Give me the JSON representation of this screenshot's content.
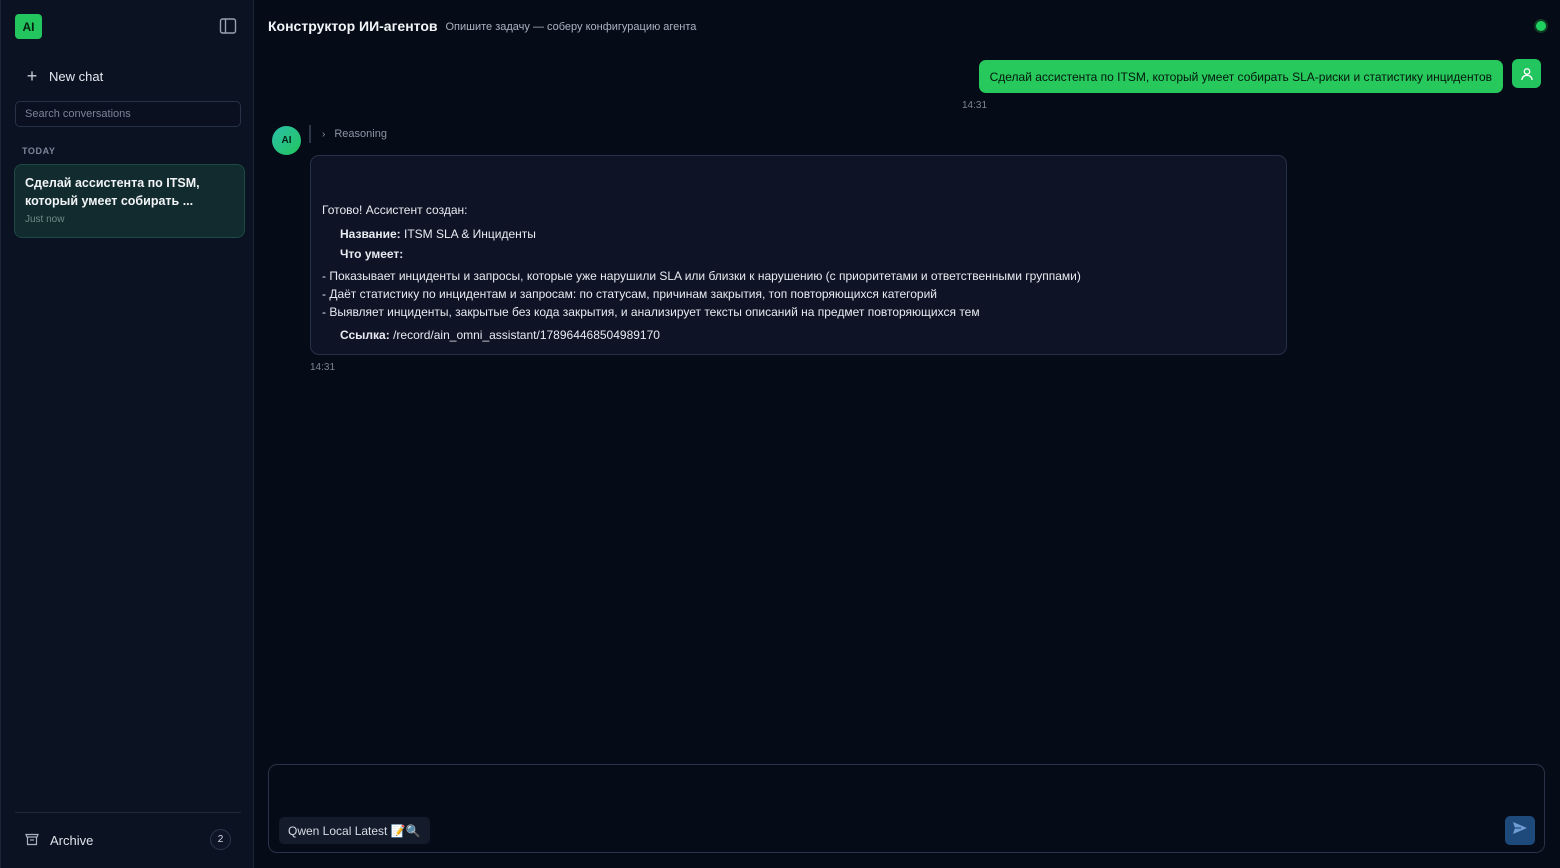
{
  "sidebar": {
    "logo_text": "AI",
    "new_chat_label": "New chat",
    "search_placeholder": "Search conversations",
    "section_today": "TODAY",
    "conversations": [
      {
        "title": "Сделай ассистента по ITSM, который умеет собирать ...",
        "time": "Just now"
      }
    ],
    "archive_label": "Archive",
    "archive_count": "2"
  },
  "header": {
    "title": "Конструктор ИИ-агентов",
    "subtitle": "Опишите задачу — соберу конфигурацию агента",
    "status_color": "#1fd15f"
  },
  "messages": {
    "user": {
      "text": "Сделай ассистента по ITSM, который умеет собирать SLA-риски и статистику инцидентов",
      "time": "14:31"
    },
    "assistant": {
      "avatar_text": "AI",
      "reasoning_label": "Reasoning",
      "intro": "Готово! Ассистент создан:",
      "name_label": "Название:",
      "name_value": "ITSM SLA & Инциденты",
      "can_label": "Что умеет:",
      "bullets": [
        "- Показывает инциденты и запросы, которые уже нарушили SLA или близки к нарушению (с приоритетами и ответственными группами)",
        "- Даёт статистику по инцидентам и запросам: по статусам, причинам закрытия, топ повторяющихся категорий",
        "- Выявляет инциденты, закрытые без кода закрытия, и анализирует тексты описаний на предмет повторяющихся тем"
      ],
      "link_label": "Ссылка:",
      "link_value": "/record/ain_omni_assistant/178964468504989170",
      "time": "14:31"
    }
  },
  "composer": {
    "input_value": "",
    "model_label": "Qwen Local Latest 📝🔍"
  },
  "colors": {
    "accent": "#22c55e",
    "background": "#060b18",
    "sidebar": "#0b1222",
    "send_button": "#1d4a7a"
  }
}
